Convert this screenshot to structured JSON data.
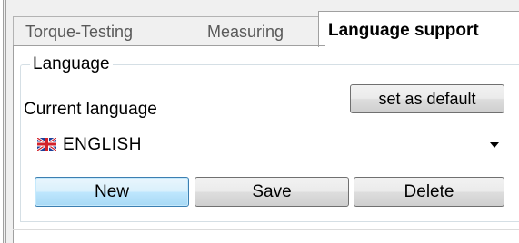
{
  "tabs": [
    {
      "label": "Torque-Testing"
    },
    {
      "label": "Measuring"
    },
    {
      "label": "Language support",
      "active": true
    }
  ],
  "language_group": {
    "title": "Language",
    "current_label": "Current language",
    "set_default_label": "set as default",
    "selected_language": "ENGLISH",
    "selected_flag_icon": "uk-flag-icon"
  },
  "actions": {
    "new_label": "New",
    "save_label": "Save",
    "delete_label": "Delete"
  }
}
